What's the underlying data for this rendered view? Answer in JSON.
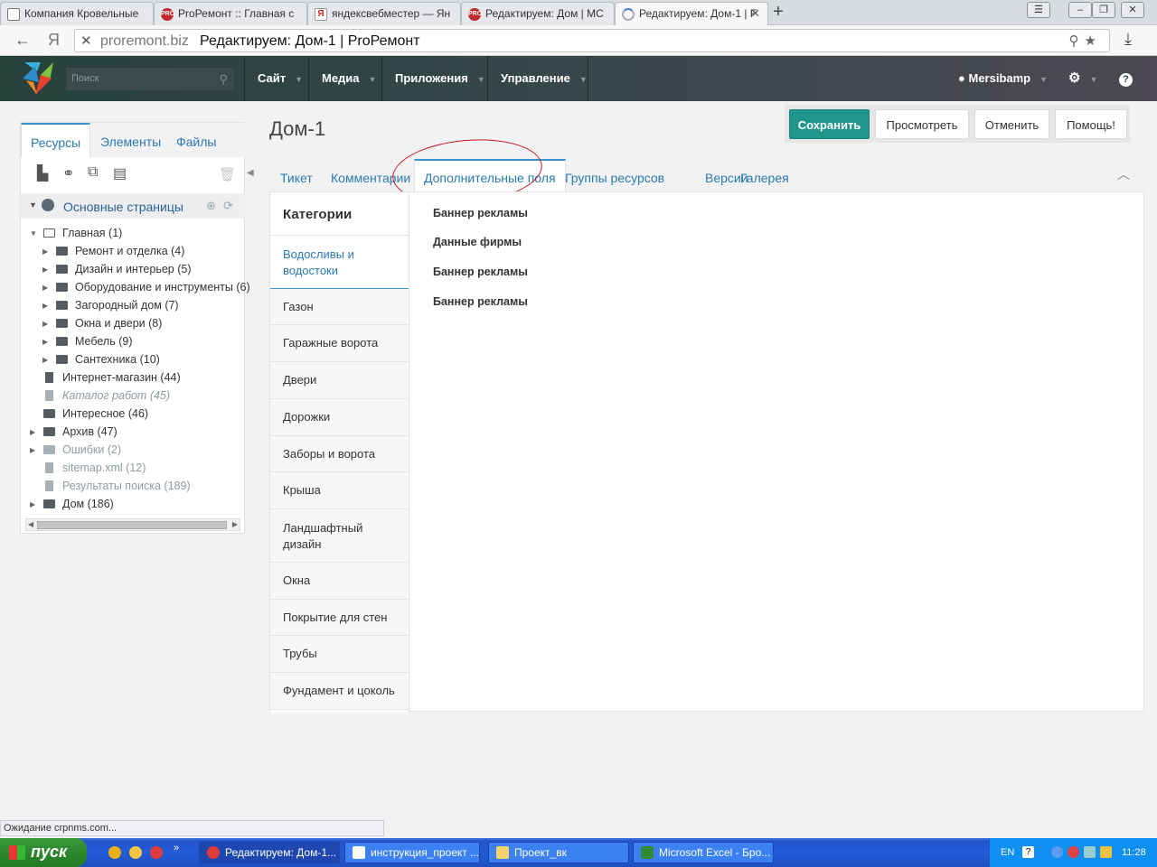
{
  "browser": {
    "tabs": [
      {
        "label": "Компания Кровельные",
        "icon": "doc"
      },
      {
        "label": "ProРемонт :: Главная с",
        "icon": "pro"
      },
      {
        "label": "яндексвебместер — Ян",
        "icon": "ya"
      },
      {
        "label": "Редактируем: Дом | MC",
        "icon": "pro"
      },
      {
        "label": "Редактируем: Дом-1 | F",
        "icon": "spin"
      }
    ],
    "address_domain": "proremont.biz",
    "address_title": "Редактируем: Дом-1 | ProРемонт",
    "status_text": "Ожидание crpnms.com..."
  },
  "header": {
    "search_placeholder": "Поиск",
    "menu": [
      "Сайт",
      "Медиа",
      "Приложения",
      "Управление"
    ],
    "user": "Mersibamp"
  },
  "left_panel": {
    "tabs": [
      "Ресурсы",
      "Элементы",
      "Файлы"
    ],
    "root": "Основные страницы",
    "tree": [
      {
        "label": "Главная (1)",
        "level": 0,
        "type": "folder-open",
        "toggle": "open"
      },
      {
        "label": "Ремонт и отделка (4)",
        "level": 1,
        "type": "folder",
        "toggle": "closed"
      },
      {
        "label": "Дизайн и интерьер (5)",
        "level": 1,
        "type": "folder",
        "toggle": "closed"
      },
      {
        "label": "Оборудование и инструменты (6)",
        "level": 1,
        "type": "folder",
        "toggle": "closed"
      },
      {
        "label": "Загородный дом (7)",
        "level": 1,
        "type": "folder",
        "toggle": "closed"
      },
      {
        "label": "Окна и двери (8)",
        "level": 1,
        "type": "folder",
        "toggle": "closed"
      },
      {
        "label": "Мебель (9)",
        "level": 1,
        "type": "folder",
        "toggle": "closed"
      },
      {
        "label": "Сантехника (10)",
        "level": 1,
        "type": "folder",
        "toggle": "closed"
      },
      {
        "label": "Интернет-магазин (44)",
        "level": 0,
        "type": "file",
        "toggle": "none"
      },
      {
        "label": "Каталог работ (45)",
        "level": 0,
        "type": "file",
        "toggle": "none",
        "style": "grey-italic"
      },
      {
        "label": "Интересное (46)",
        "level": 0,
        "type": "folder",
        "toggle": "none"
      },
      {
        "label": "Архив (47)",
        "level": 0,
        "type": "folder",
        "toggle": "closed"
      },
      {
        "label": "Ошибки (2)",
        "level": 0,
        "type": "folder",
        "toggle": "closed",
        "style": "grey"
      },
      {
        "label": "sitemap.xml (12)",
        "level": 0,
        "type": "file",
        "toggle": "none",
        "style": "grey"
      },
      {
        "label": "Результаты поиска (189)",
        "level": 0,
        "type": "file",
        "toggle": "none",
        "style": "grey"
      },
      {
        "label": "Дом (186)",
        "level": 0,
        "type": "folder",
        "toggle": "closed"
      }
    ]
  },
  "page": {
    "title": "Дом-1",
    "actions": [
      "Сохранить",
      "Просмотреть",
      "Отменить",
      "Помощь!"
    ],
    "tabs": [
      "Тикет",
      "Комментарии",
      "Дополнительные поля",
      "Группы ресурсов",
      "Версии",
      "Галерея"
    ],
    "active_tab": "Дополнительные поля",
    "categories_header": "Категории",
    "categories": [
      "Водосливы и водостоки",
      "Газон",
      "Гаражные ворота",
      "Двери",
      "Дорожки",
      "Заборы и ворота",
      "Крыша",
      "Ландшафтный дизайн",
      "Окна",
      "Покрытие для стен",
      "Трубы",
      "Фундамент и цоколь"
    ],
    "fields": [
      "Баннер рекламы",
      "Данные фирмы",
      "Баннер рекламы",
      "Баннер рекламы"
    ]
  },
  "taskbar": {
    "start": "пуск",
    "windows": [
      "Редактируем: Дом-1...",
      "инструкция_проект ...",
      "Проект_вк",
      "Microsoft Excel - Бро..."
    ],
    "lang": "EN",
    "clock": "11:28"
  },
  "colors": {
    "primary": "#1f968c",
    "link": "#2a7ab0",
    "tab_accent": "#3697cd",
    "header": "#354649",
    "annotation": "#c4151c"
  }
}
